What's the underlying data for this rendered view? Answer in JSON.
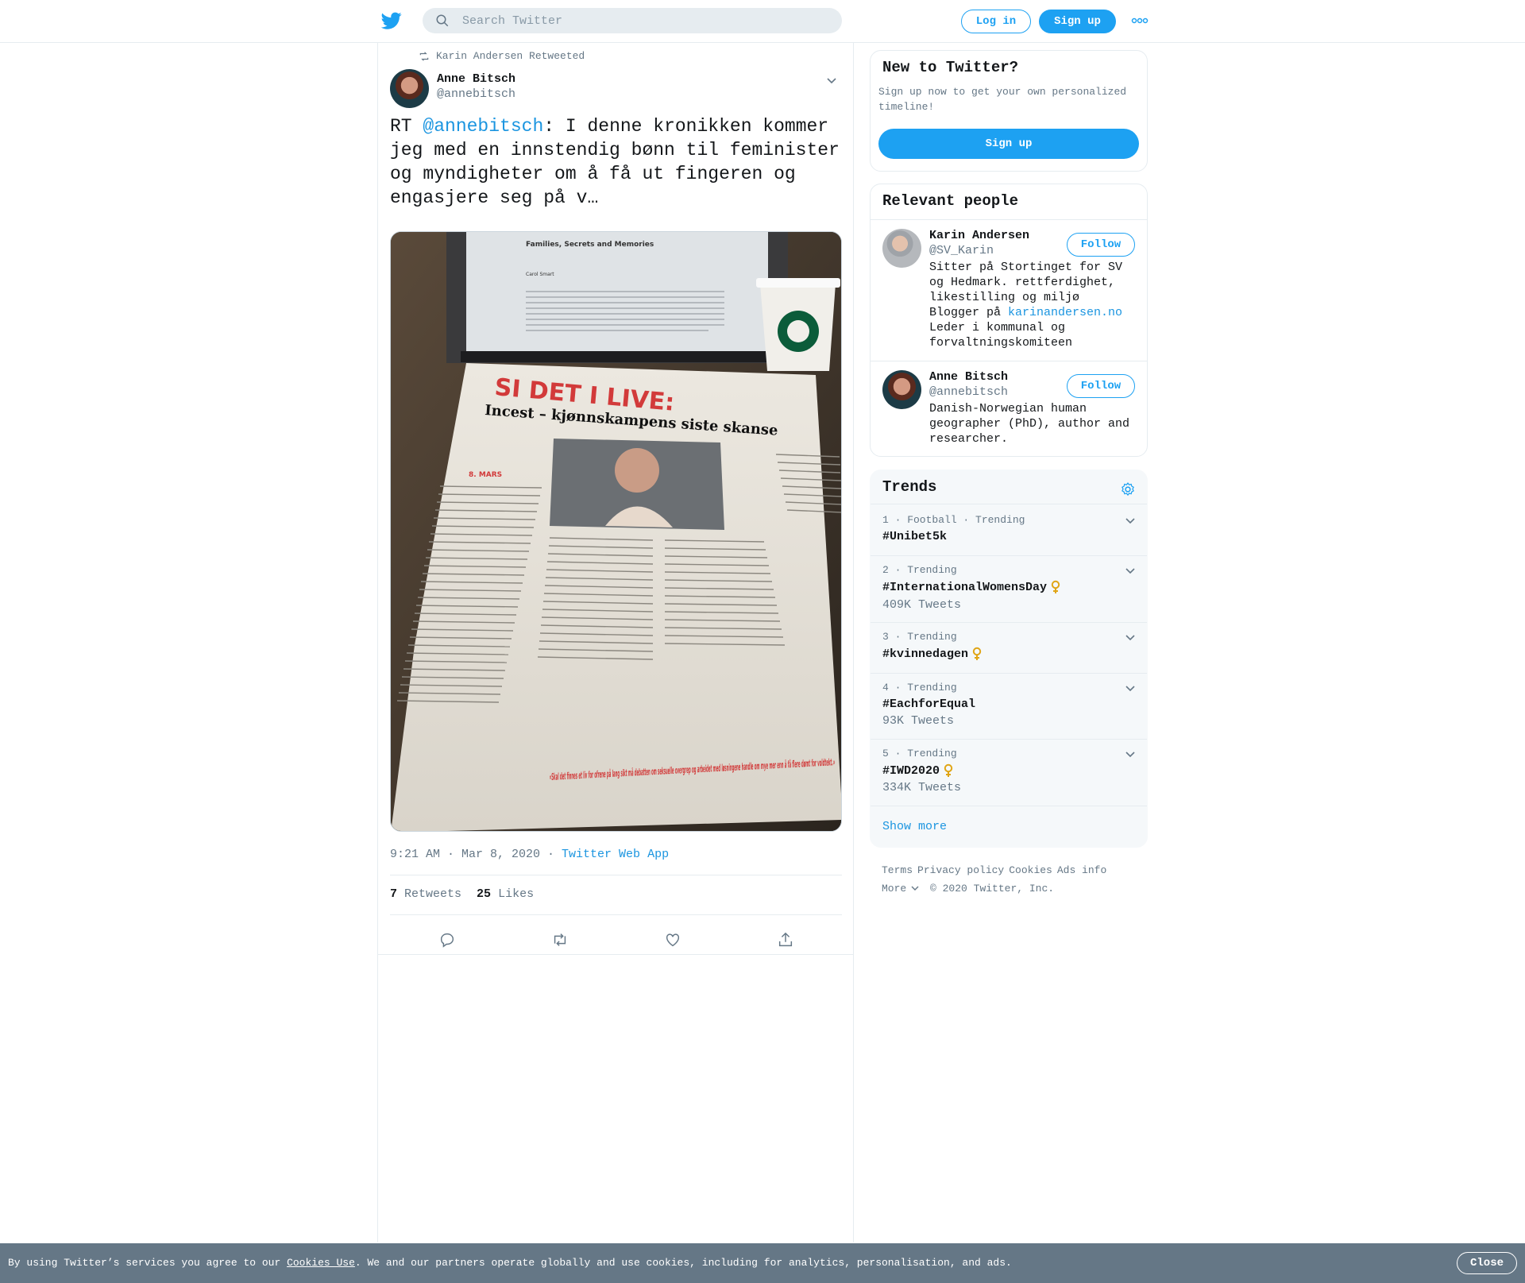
{
  "header": {
    "search_placeholder": "Search Twitter",
    "login_label": "Log in",
    "signup_label": "Sign up",
    "brand_color": "#1da1f2"
  },
  "tweet": {
    "retweet_context": "Karin Andersen Retweeted",
    "author_name": "Anne Bitsch",
    "author_handle": "@annebitsch",
    "text_prefix": "RT ",
    "text_mention": "@annebitsch",
    "text_body": ": I denne kronikken kommer jeg med en innstendig bønn til feminister og myndigheter om å få ut fingeren og engasjere seg på v…",
    "media": {
      "headline": "SI DET I LIVE:",
      "subheadline": "Incest – kjønnskampens siste skanse",
      "date_label": "8. MARS",
      "laptop_doc_title": "Families, Secrets and Memories",
      "laptop_doc_author": "Carol Smart",
      "pull_quote": "«Skal det finnes et liv for ofrene på lang sikt må debatten om seksuelle overgrep og arbeidet med løsningene handle om mye mer enn å få flere dømt for voldtekt.»"
    },
    "timestamp": "9:21 AM · Mar 8, 2020",
    "separator": " · ",
    "source": "Twitter Web App",
    "retweets_count": "7",
    "retweets_label": "Retweets",
    "likes_count": "25",
    "likes_label": "Likes",
    "action_icons": [
      "reply-icon",
      "retweet-icon",
      "like-icon",
      "share-icon"
    ]
  },
  "signup_card": {
    "title": "New to Twitter?",
    "subtitle": "Sign up now to get your own personalized timeline!",
    "button": "Sign up"
  },
  "relevant_people": {
    "title": "Relevant people",
    "people": [
      {
        "name": "Karin Andersen",
        "handle": "@SV_Karin",
        "bio_before_link": "Sitter på Stortinget for SV og Hedmark. rettferdighet, likestilling og miljø\nBlogger på ",
        "bio_link": "karinandersen.no",
        "bio_after_link": "\nLeder i kommunal og forvaltningskomiteen",
        "follow_label": "Follow"
      },
      {
        "name": "Anne Bitsch",
        "handle": "@annebitsch",
        "bio_before_link": "Danish-Norwegian human geographer (PhD), author and researcher.",
        "bio_link": "",
        "bio_after_link": "",
        "follow_label": "Follow"
      }
    ]
  },
  "trends": {
    "title": "Trends",
    "items": [
      {
        "meta": "1 · Football · Trending",
        "name": "#Unibet5k",
        "count": "",
        "emoji": false
      },
      {
        "meta": "2 · Trending",
        "name": "#InternationalWomensDay",
        "count": "409K Tweets",
        "emoji": true
      },
      {
        "meta": "3 · Trending",
        "name": "#kvinnedagen",
        "count": "",
        "emoji": true
      },
      {
        "meta": "4 · Trending",
        "name": "#EachforEqual",
        "count": "93K Tweets",
        "emoji": false
      },
      {
        "meta": "5 · Trending",
        "name": "#IWD2020",
        "count": "334K Tweets",
        "emoji": true
      }
    ],
    "show_more": "Show more"
  },
  "footer": {
    "links": [
      "Terms",
      "Privacy policy",
      "Cookies",
      "Ads info"
    ],
    "more": "More",
    "copyright": "© 2020 Twitter, Inc."
  },
  "cookie_bar": {
    "before_link": "By using Twitter’s services you agree to our ",
    "link": "Cookies Use",
    "after_link": ". We and our partners operate globally and use cookies, including for analytics, personalisation, and ads.",
    "close_label": "Close"
  }
}
